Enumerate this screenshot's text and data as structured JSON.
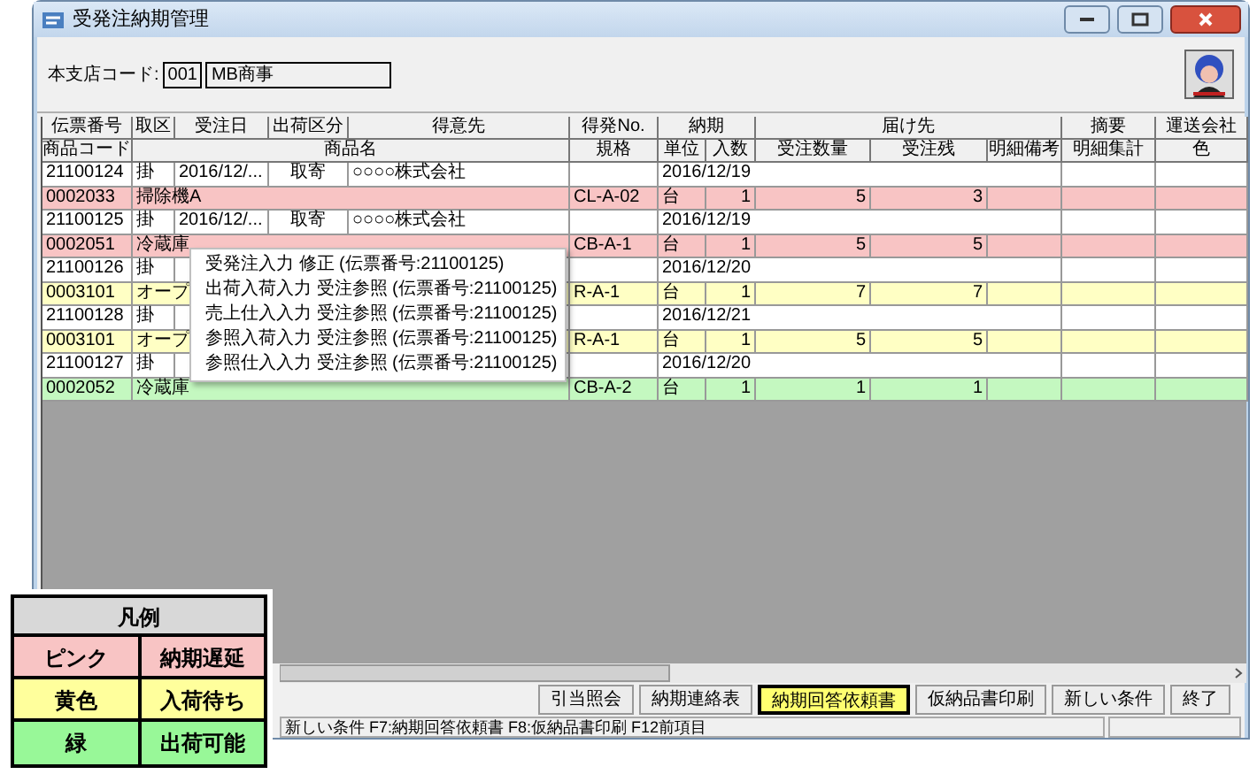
{
  "window": {
    "title": "受発注納期管理"
  },
  "branch": {
    "label": "本支店コード:",
    "code": "001",
    "name": "MB商事"
  },
  "table": {
    "header_rows": [
      [
        "伝票番号",
        "取区",
        "受注日",
        "出荷区分",
        "得意先",
        "得発No.",
        "納期",
        "届け先",
        "摘要",
        "運送会社"
      ],
      [
        "商品コード",
        "商品名",
        "規格",
        "単位",
        "入数",
        "受注数量",
        "受注残",
        "明細備考",
        "明細集計",
        "色"
      ]
    ],
    "rows": [
      {
        "kind": "order",
        "slip_no": "21100124",
        "type": "掛",
        "order_date": "2016/12/...",
        "ship_type": "取寄",
        "customer": "○○○○株式会社",
        "delivery_date": "2016/12/19"
      },
      {
        "kind": "item",
        "color": "#f8c4c4",
        "code": "0002033",
        "name": "掃除機A",
        "spec": "CL-A-02",
        "unit": "台",
        "pack": "1",
        "order_qty": "5",
        "remaining": "3"
      },
      {
        "kind": "order",
        "slip_no": "21100125",
        "type": "掛",
        "order_date": "2016/12/...",
        "ship_type": "取寄",
        "customer": "○○○○株式会社",
        "delivery_date": "2016/12/19"
      },
      {
        "kind": "item",
        "color": "#f8c4c4",
        "code": "0002051",
        "name": "冷蔵庫",
        "spec": "CB-A-1",
        "unit": "台",
        "pack": "1",
        "order_qty": "5",
        "remaining": "5"
      },
      {
        "kind": "order",
        "slip_no": "21100126",
        "type": "掛",
        "delivery_date": "2016/12/20"
      },
      {
        "kind": "item",
        "color": "#ffffc4",
        "code": "0003101",
        "name": "オープ",
        "spec": "R-A-1",
        "unit": "台",
        "pack": "1",
        "order_qty": "7",
        "remaining": "7"
      },
      {
        "kind": "order",
        "slip_no": "21100128",
        "type": "掛",
        "delivery_date": "2016/12/21"
      },
      {
        "kind": "item",
        "color": "#ffffc4",
        "code": "0003101",
        "name": "オープ",
        "spec": "R-A-1",
        "unit": "台",
        "pack": "1",
        "order_qty": "5",
        "remaining": "5"
      },
      {
        "kind": "order",
        "slip_no": "21100127",
        "type": "掛",
        "delivery_date": "2016/12/20"
      },
      {
        "kind": "item",
        "color": "#c4f8c0",
        "code": "0002052",
        "name": "冷蔵庫",
        "spec": "CB-A-2",
        "unit": "台",
        "pack": "1",
        "order_qty": "1",
        "remaining": "1"
      }
    ]
  },
  "context_menu": {
    "items": [
      {
        "label": "受発注入力 修正 (伝票番号:21100125)"
      },
      {
        "label": "出荷入荷入力 受注参照 (伝票番号:21100125)"
      },
      {
        "label": "売上仕入入力 受注参照 (伝票番号:21100125)"
      },
      {
        "label": "参照入荷入力 受注参照 (伝票番号:21100125)"
      },
      {
        "label": "参照仕入入力 受注参照 (伝票番号:21100125)"
      }
    ]
  },
  "buttons": [
    {
      "label": "引当照会",
      "selected": false
    },
    {
      "label": "納期連絡表",
      "selected": false
    },
    {
      "label": "納期回答依頼書",
      "selected": true
    },
    {
      "label": "仮納品書印刷",
      "selected": false
    },
    {
      "label": "新しい条件",
      "selected": false
    },
    {
      "label": "終了",
      "selected": false
    }
  ],
  "status_bar": {
    "text": "新しい条件 F7:納期回答依頼書 F8:仮納品書印刷 F12前項目"
  },
  "legend": {
    "title": "凡例",
    "items": [
      {
        "color": "#f8c4c4",
        "name": "ピンク",
        "meaning": "納期遅延"
      },
      {
        "color": "#ffff9c",
        "name": "黄色",
        "meaning": "入荷待ち"
      },
      {
        "color": "#98f898",
        "name": "緑",
        "meaning": "出荷可能"
      }
    ]
  }
}
